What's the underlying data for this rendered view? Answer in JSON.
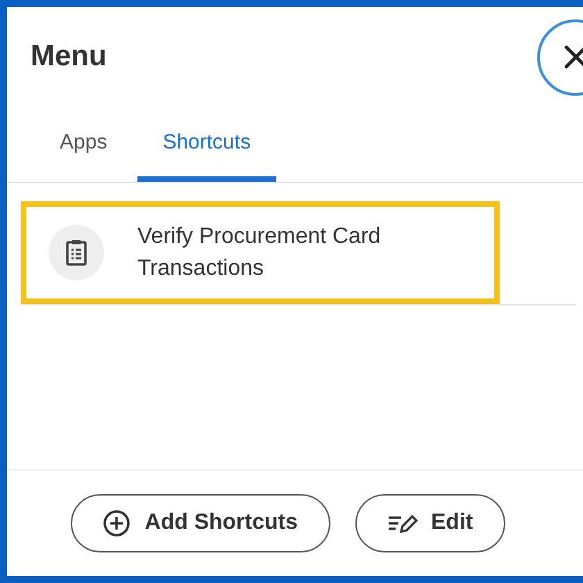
{
  "header": {
    "title": "Menu"
  },
  "tabs": [
    {
      "label": "Apps",
      "selected": false
    },
    {
      "label": "Shortcuts",
      "selected": true
    }
  ],
  "shortcuts": [
    {
      "label": "Verify Procurement Card Transactions",
      "highlighted": true
    }
  ],
  "buttons": [
    {
      "kind": "add",
      "label": "Add Shortcuts"
    },
    {
      "kind": "edit",
      "label": "Edit"
    }
  ]
}
